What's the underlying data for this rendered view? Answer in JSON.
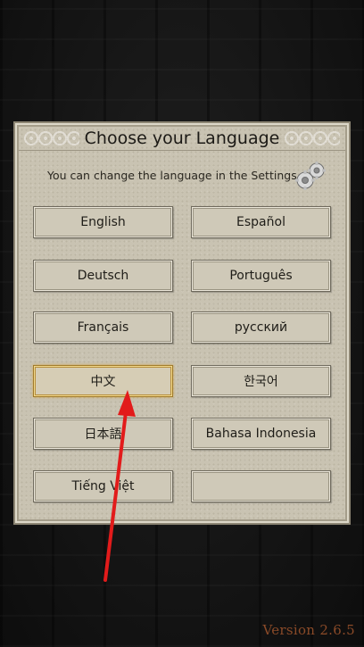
{
  "dialog": {
    "title": "Choose your Language",
    "subtitle": "You can change the language in the Settings.",
    "settings_icon": "gears-icon"
  },
  "languages": [
    {
      "label": "English"
    },
    {
      "label": "Español"
    },
    {
      "label": "Deutsch"
    },
    {
      "label": "Português"
    },
    {
      "label": "Français"
    },
    {
      "label": "русский"
    },
    {
      "label": "中文",
      "selected": true
    },
    {
      "label": "한국어"
    },
    {
      "label": "日本語"
    },
    {
      "label": "Bahasa Indonesia"
    },
    {
      "label": "Tiếng Việt"
    },
    {
      "label": ""
    }
  ],
  "annotation": {
    "icon": "red-arrow-icon",
    "color": "#e21b1b"
  },
  "footer": {
    "version": "Version 2.6.5"
  },
  "colors": {
    "panel": "#c9c3b2",
    "selected_border": "#b88f3a",
    "version_text": "#8a4a28"
  }
}
